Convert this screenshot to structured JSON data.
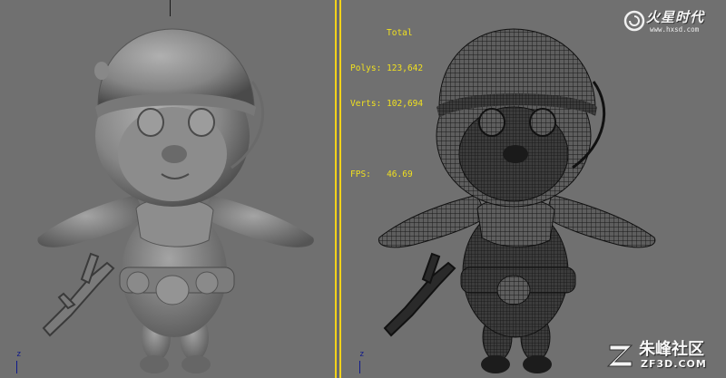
{
  "left_viewport": {
    "axis_label": "z"
  },
  "right_viewport": {
    "axis_label": "z",
    "stats": {
      "header": "Total",
      "polys_label": "Polys:",
      "polys_value": "123,642",
      "verts_label": "Verts:",
      "verts_value": "102,694",
      "fps_label": "FPS:",
      "fps_value": "46.69"
    }
  },
  "watermark_top": {
    "title": "火星时代",
    "url": "www.hxsd.com",
    "icon": "spiral-logo-icon"
  },
  "watermark_bottom": {
    "title": "朱峰社区",
    "url": "ZF3D.COM",
    "icon": "z-logo-icon"
  },
  "colors": {
    "viewport_bg": "#707070",
    "active_border": "#f2d21b",
    "stats_text": "#f0e020",
    "model_shade": "#8a8a8a",
    "wire": "#1a1a1a"
  }
}
